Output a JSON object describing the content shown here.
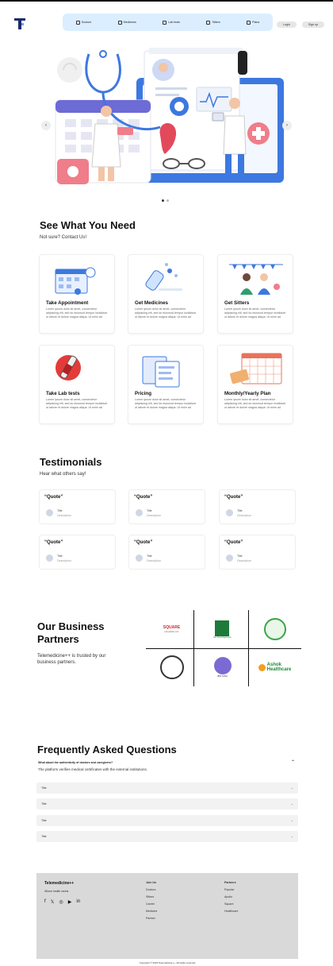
{
  "header": {
    "logo_letter": "T",
    "nav": [
      {
        "label": "Doctors",
        "icon": "doctor-icon"
      },
      {
        "label": "Medicines",
        "icon": "pill-icon"
      },
      {
        "label": "Lab tests",
        "icon": "flask-icon"
      },
      {
        "label": "Sitters",
        "icon": "person-icon"
      },
      {
        "label": "Plans",
        "icon": "calendar-icon"
      }
    ],
    "login": "Login",
    "signup": "Sign up",
    "accent": "#dbeeff"
  },
  "hero": {
    "prev": "‹",
    "next": "›",
    "slides": 2,
    "active_slide": 1
  },
  "services": {
    "title": "See What You Need",
    "subtitle": "Not sure? Contact Us!",
    "items": [
      {
        "title": "Take Appointment",
        "desc": "Lorem ipsum dolor sit amet, consectetur adipiscing elit, sed do eiusmod tempor incididunt ut labore et dolore magna aliqua. Ut enim ad"
      },
      {
        "title": "Get Medicines",
        "desc": "Lorem ipsum dolor sit amet, consectetur adipiscing elit, sed do eiusmod tempor incididunt ut labore et dolore magna aliqua. Ut enim ad"
      },
      {
        "title": "Get Sitters",
        "desc": "Lorem ipsum dolor sit amet, consectetur adipiscing elit, sed do eiusmod tempor incididunt ut labore et dolore magna aliqua. Ut enim ad"
      },
      {
        "title": "Take Lab tests",
        "desc": "Lorem ipsum dolor sit amet, consectetur adipiscing elit, sed do eiusmod tempor incididunt ut labore et dolore magna aliqua. Ut enim ad"
      },
      {
        "title": "Pricing",
        "desc": "Lorem ipsum dolor sit amet, consectetur adipiscing elit, sed do eiusmod tempor incididunt ut labore et dolore magna aliqua. Ut enim ad"
      },
      {
        "title": "Monthly/Yearly Plan",
        "desc": "Lorem ipsum dolor sit amet, consectetur adipiscing elit, sed do eiusmod tempor incididunt ut labore et dolore magna aliqua. Ut enim ad"
      }
    ]
  },
  "testimonials": {
    "title": "Testimonials",
    "subtitle": "Hear what others say!",
    "quote": "“Quote”",
    "name": "Title",
    "desc": "Description"
  },
  "partners": {
    "title_line1": "Our Business",
    "title_line2": "Partners",
    "desc_line1": "Telemedicine++ is trusted by our",
    "desc_line2": "business partners.",
    "logos": [
      {
        "name": "SQUARE",
        "sub": "Hospitals Ltd."
      },
      {
        "name": "",
        "sub": "Ibn Sina Diagnostic"
      },
      {
        "name": "",
        "sub": ""
      },
      {
        "name": "",
        "sub": ""
      },
      {
        "name": "IBN SINA",
        "sub": ""
      },
      {
        "name": "Ashok",
        "sub": "Healthcare"
      }
    ]
  },
  "faq": {
    "title": "Frequently Asked Questions",
    "open_q": "What about the authenticity of doctors and caregivers?",
    "open_a": "The platform verifies medical certificates with the external institutions.",
    "rows": [
      "Title",
      "Title",
      "Title",
      "Title",
      "Title"
    ]
  },
  "footer": {
    "brand": "Telemedicine++",
    "tagline": "Where health meets",
    "join_title": "Join Us",
    "join_items": [
      "Doctors",
      "Sitters",
      "Carrier",
      "Medicine",
      "Partner"
    ],
    "partners_title": "Partners",
    "partner_items": [
      "Popular",
      "Apollo",
      "Square",
      "Healthcare"
    ],
    "copyright": "Copyright © 2023 Telemedicine++. All rights reserved"
  }
}
